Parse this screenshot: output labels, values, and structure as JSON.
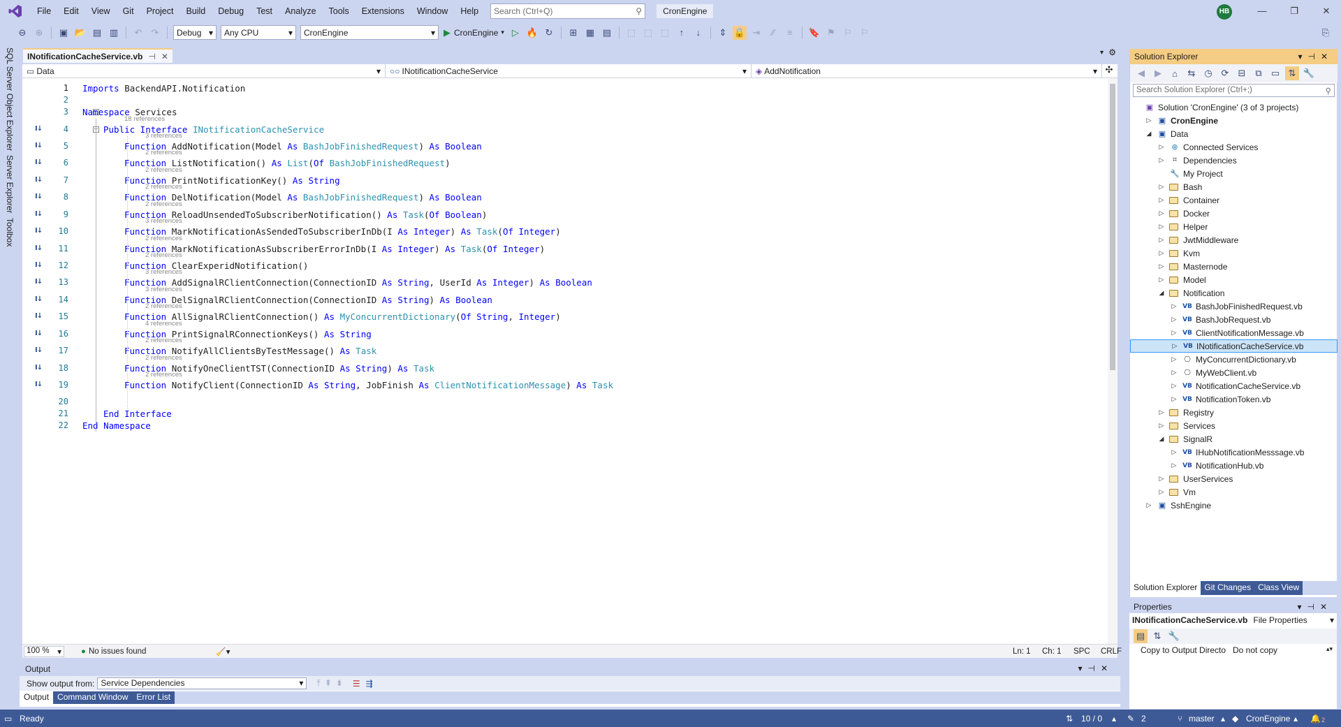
{
  "titlebar": {
    "menu": [
      "File",
      "Edit",
      "View",
      "Git",
      "Project",
      "Build",
      "Debug",
      "Test",
      "Analyze",
      "Tools",
      "Extensions",
      "Window",
      "Help"
    ],
    "search_placeholder": "Search (Ctrl+Q)",
    "solution_name": "CronEngine",
    "user_initials": "HB"
  },
  "toolbar": {
    "configuration": "Debug",
    "platform": "Any CPU",
    "startup_project": "CronEngine",
    "run_label": "CronEngine"
  },
  "left_rail": [
    "SQL Server Object Explorer",
    "Server Explorer",
    "Toolbox"
  ],
  "editor": {
    "tab_title": "INotificationCacheService.vb",
    "nav": {
      "project": "Data",
      "type": "INotificationCacheService",
      "member": "AddNotification"
    },
    "lines": [
      {
        "n": "1",
        "refs": "",
        "tokens": [
          {
            "t": "Imports",
            "c": "kw"
          },
          {
            "t": " BackendAPI.Notification",
            "c": ""
          }
        ]
      },
      {
        "n": "2",
        "refs": "",
        "tokens": []
      },
      {
        "n": "3",
        "refs": "",
        "tokens": [
          {
            "t": "Namespace",
            "c": "kw"
          },
          {
            "t": " Services",
            "c": ""
          }
        ]
      },
      {
        "n": "4",
        "refs": "18 references",
        "tokens": [
          {
            "t": "Public Interface",
            "c": "kw"
          },
          {
            "t": " ",
            "c": ""
          },
          {
            "t": "INotificationCacheService",
            "c": "ty"
          }
        ]
      },
      {
        "n": "5",
        "refs": "3 references",
        "tokens": [
          {
            "t": "Function",
            "c": "kw"
          },
          {
            "t": " AddNotification(Model ",
            "c": ""
          },
          {
            "t": "As",
            "c": "kw"
          },
          {
            "t": " ",
            "c": ""
          },
          {
            "t": "BashJobFinishedRequest",
            "c": "ty"
          },
          {
            "t": ") ",
            "c": ""
          },
          {
            "t": "As",
            "c": "kw"
          },
          {
            "t": " ",
            "c": ""
          },
          {
            "t": "Boolean",
            "c": "kw"
          }
        ]
      },
      {
        "n": "6",
        "refs": "2 references",
        "tokens": [
          {
            "t": "Function",
            "c": "kw"
          },
          {
            "t": " ListNotification() ",
            "c": ""
          },
          {
            "t": "As",
            "c": "kw"
          },
          {
            "t": " ",
            "c": ""
          },
          {
            "t": "List",
            "c": "ty"
          },
          {
            "t": "(",
            "c": ""
          },
          {
            "t": "Of",
            "c": "kw"
          },
          {
            "t": " ",
            "c": ""
          },
          {
            "t": "BashJobFinishedRequest",
            "c": "ty"
          },
          {
            "t": ")",
            "c": ""
          }
        ]
      },
      {
        "n": "7",
        "refs": "2 references",
        "tokens": [
          {
            "t": "Function",
            "c": "kw"
          },
          {
            "t": " PrintNotificationKey() ",
            "c": ""
          },
          {
            "t": "As",
            "c": "kw"
          },
          {
            "t": " ",
            "c": ""
          },
          {
            "t": "String",
            "c": "kw"
          }
        ]
      },
      {
        "n": "8",
        "refs": "2 references",
        "tokens": [
          {
            "t": "Function",
            "c": "kw"
          },
          {
            "t": " DelNotification(Model ",
            "c": ""
          },
          {
            "t": "As",
            "c": "kw"
          },
          {
            "t": " ",
            "c": ""
          },
          {
            "t": "BashJobFinishedRequest",
            "c": "ty"
          },
          {
            "t": ") ",
            "c": ""
          },
          {
            "t": "As",
            "c": "kw"
          },
          {
            "t": " ",
            "c": ""
          },
          {
            "t": "Boolean",
            "c": "kw"
          }
        ]
      },
      {
        "n": "9",
        "refs": "2 references",
        "tokens": [
          {
            "t": "Function",
            "c": "kw"
          },
          {
            "t": " ReloadUnsendedToSubscriberNotification() ",
            "c": ""
          },
          {
            "t": "As",
            "c": "kw"
          },
          {
            "t": " ",
            "c": ""
          },
          {
            "t": "Task",
            "c": "ty"
          },
          {
            "t": "(",
            "c": ""
          },
          {
            "t": "Of",
            "c": "kw"
          },
          {
            "t": " ",
            "c": ""
          },
          {
            "t": "Boolean",
            "c": "kw"
          },
          {
            "t": ")",
            "c": ""
          }
        ]
      },
      {
        "n": "10",
        "refs": "3 references",
        "tokens": [
          {
            "t": "Function",
            "c": "kw"
          },
          {
            "t": " MarkNotificationAsSendedToSubscriberInDb(I ",
            "c": ""
          },
          {
            "t": "As",
            "c": "kw"
          },
          {
            "t": " ",
            "c": ""
          },
          {
            "t": "Integer",
            "c": "kw"
          },
          {
            "t": ") ",
            "c": ""
          },
          {
            "t": "As",
            "c": "kw"
          },
          {
            "t": " ",
            "c": ""
          },
          {
            "t": "Task",
            "c": "ty"
          },
          {
            "t": "(",
            "c": ""
          },
          {
            "t": "Of",
            "c": "kw"
          },
          {
            "t": " ",
            "c": ""
          },
          {
            "t": "Integer",
            "c": "kw"
          },
          {
            "t": ")",
            "c": ""
          }
        ]
      },
      {
        "n": "11",
        "refs": "2 references",
        "tokens": [
          {
            "t": "Function",
            "c": "kw"
          },
          {
            "t": " MarkNotificationAsSubscriberErrorInDb(I ",
            "c": ""
          },
          {
            "t": "As",
            "c": "kw"
          },
          {
            "t": " ",
            "c": ""
          },
          {
            "t": "Integer",
            "c": "kw"
          },
          {
            "t": ") ",
            "c": ""
          },
          {
            "t": "As",
            "c": "kw"
          },
          {
            "t": " ",
            "c": ""
          },
          {
            "t": "Task",
            "c": "ty"
          },
          {
            "t": "(",
            "c": ""
          },
          {
            "t": "Of",
            "c": "kw"
          },
          {
            "t": " ",
            "c": ""
          },
          {
            "t": "Integer",
            "c": "kw"
          },
          {
            "t": ")",
            "c": ""
          }
        ]
      },
      {
        "n": "12",
        "refs": "2 references",
        "tokens": [
          {
            "t": "Function",
            "c": "kw"
          },
          {
            "t": " ClearExperidNotification()",
            "c": ""
          }
        ]
      },
      {
        "n": "13",
        "refs": "3 references",
        "tokens": [
          {
            "t": "Function",
            "c": "kw"
          },
          {
            "t": " AddSignalRClientConnection(ConnectionID ",
            "c": ""
          },
          {
            "t": "As",
            "c": "kw"
          },
          {
            "t": " ",
            "c": ""
          },
          {
            "t": "String",
            "c": "kw"
          },
          {
            "t": ", UserId ",
            "c": ""
          },
          {
            "t": "As",
            "c": "kw"
          },
          {
            "t": " ",
            "c": ""
          },
          {
            "t": "Integer",
            "c": "kw"
          },
          {
            "t": ") ",
            "c": ""
          },
          {
            "t": "As",
            "c": "kw"
          },
          {
            "t": " ",
            "c": ""
          },
          {
            "t": "Boolean",
            "c": "kw"
          }
        ]
      },
      {
        "n": "14",
        "refs": "3 references",
        "tokens": [
          {
            "t": "Function",
            "c": "kw"
          },
          {
            "t": " DelSignalRClientConnection(ConnectionID ",
            "c": ""
          },
          {
            "t": "As",
            "c": "kw"
          },
          {
            "t": " ",
            "c": ""
          },
          {
            "t": "String",
            "c": "kw"
          },
          {
            "t": ") ",
            "c": ""
          },
          {
            "t": "As",
            "c": "kw"
          },
          {
            "t": " ",
            "c": ""
          },
          {
            "t": "Boolean",
            "c": "kw"
          }
        ]
      },
      {
        "n": "15",
        "refs": "2 references",
        "tokens": [
          {
            "t": "Function",
            "c": "kw"
          },
          {
            "t": " AllSignalRClientConnection() ",
            "c": ""
          },
          {
            "t": "As",
            "c": "kw"
          },
          {
            "t": " ",
            "c": ""
          },
          {
            "t": "MyConcurrentDictionary",
            "c": "ty"
          },
          {
            "t": "(",
            "c": ""
          },
          {
            "t": "Of",
            "c": "kw"
          },
          {
            "t": " ",
            "c": ""
          },
          {
            "t": "String",
            "c": "kw"
          },
          {
            "t": ", ",
            "c": ""
          },
          {
            "t": "Integer",
            "c": "kw"
          },
          {
            "t": ")",
            "c": ""
          }
        ]
      },
      {
        "n": "16",
        "refs": "4 references",
        "tokens": [
          {
            "t": "Function",
            "c": "kw"
          },
          {
            "t": " PrintSignalRConnectionKeys() ",
            "c": ""
          },
          {
            "t": "As",
            "c": "kw"
          },
          {
            "t": " ",
            "c": ""
          },
          {
            "t": "String",
            "c": "kw"
          }
        ]
      },
      {
        "n": "17",
        "refs": "2 references",
        "tokens": [
          {
            "t": "Function",
            "c": "kw"
          },
          {
            "t": " NotifyAllClientsByTestMessage() ",
            "c": ""
          },
          {
            "t": "As",
            "c": "kw"
          },
          {
            "t": " ",
            "c": ""
          },
          {
            "t": "Task",
            "c": "ty"
          }
        ]
      },
      {
        "n": "18",
        "refs": "2 references",
        "tokens": [
          {
            "t": "Function",
            "c": "kw"
          },
          {
            "t": " NotifyOneClientTST(ConnectionID ",
            "c": ""
          },
          {
            "t": "As",
            "c": "kw"
          },
          {
            "t": " ",
            "c": ""
          },
          {
            "t": "String",
            "c": "kw"
          },
          {
            "t": ") ",
            "c": ""
          },
          {
            "t": "As",
            "c": "kw"
          },
          {
            "t": " ",
            "c": ""
          },
          {
            "t": "Task",
            "c": "ty"
          }
        ]
      },
      {
        "n": "19",
        "refs": "2 references",
        "tokens": [
          {
            "t": "Function",
            "c": "kw"
          },
          {
            "t": " NotifyClient(ConnectionID ",
            "c": ""
          },
          {
            "t": "As",
            "c": "kw"
          },
          {
            "t": " ",
            "c": ""
          },
          {
            "t": "String",
            "c": "kw"
          },
          {
            "t": ", JobFinish ",
            "c": ""
          },
          {
            "t": "As",
            "c": "kw"
          },
          {
            "t": " ",
            "c": ""
          },
          {
            "t": "ClientNotificationMessage",
            "c": "ty"
          },
          {
            "t": ") ",
            "c": ""
          },
          {
            "t": "As",
            "c": "kw"
          },
          {
            "t": " ",
            "c": ""
          },
          {
            "t": "Task",
            "c": "ty"
          }
        ]
      },
      {
        "n": "20",
        "refs": "",
        "tokens": []
      },
      {
        "n": "21",
        "refs": "",
        "tokens": [
          {
            "t": "End Interface",
            "c": "kw"
          }
        ]
      },
      {
        "n": "22",
        "refs": "",
        "tokens": [
          {
            "t": "End Namespace",
            "c": "kw"
          }
        ]
      }
    ],
    "status": {
      "zoom": "100 %",
      "issues": "No issues found",
      "line": "Ln: 1",
      "col": "Ch: 1",
      "whitespace": "SPC",
      "eol": "CRLF"
    }
  },
  "output": {
    "title": "Output",
    "show_from_label": "Show output from:",
    "source": "Service Dependencies",
    "tabs": [
      "Output",
      "Command Window",
      "Error List"
    ]
  },
  "solution_explorer": {
    "title": "Solution Explorer",
    "search_placeholder": "Search Solution Explorer (Ctrl+;)",
    "tree": [
      {
        "label": "Solution 'CronEngine' (3 of 3 projects)",
        "depth": 0,
        "icon": "solution",
        "tw": ""
      },
      {
        "label": "CronEngine",
        "depth": 1,
        "icon": "project",
        "tw": "▷",
        "bold": true
      },
      {
        "label": "Data",
        "depth": 1,
        "icon": "project",
        "tw": "◢"
      },
      {
        "label": "Connected Services",
        "depth": 2,
        "icon": "connected",
        "tw": "▷"
      },
      {
        "label": "Dependencies",
        "depth": 2,
        "icon": "deps",
        "tw": "▷"
      },
      {
        "label": "My Project",
        "depth": 2,
        "icon": "wrench",
        "tw": ""
      },
      {
        "label": "Bash",
        "depth": 2,
        "icon": "folder",
        "tw": "▷"
      },
      {
        "label": "Container",
        "depth": 2,
        "icon": "folder",
        "tw": "▷"
      },
      {
        "label": "Docker",
        "depth": 2,
        "icon": "folder",
        "tw": "▷"
      },
      {
        "label": "Helper",
        "depth": 2,
        "icon": "folder",
        "tw": "▷"
      },
      {
        "label": "JwtMiddleware",
        "depth": 2,
        "icon": "folder",
        "tw": "▷"
      },
      {
        "label": "Kvm",
        "depth": 2,
        "icon": "folder",
        "tw": "▷"
      },
      {
        "label": "Masternode",
        "depth": 2,
        "icon": "folder",
        "tw": "▷"
      },
      {
        "label": "Model",
        "depth": 2,
        "icon": "folder",
        "tw": "▷"
      },
      {
        "label": "Notification",
        "depth": 2,
        "icon": "folder",
        "tw": "◢"
      },
      {
        "label": "BashJobFinishedRequest.vb",
        "depth": 3,
        "icon": "vb",
        "tw": "▷"
      },
      {
        "label": "BashJobRequest.vb",
        "depth": 3,
        "icon": "vb",
        "tw": "▷"
      },
      {
        "label": "ClientNotificationMessage.vb",
        "depth": 3,
        "icon": "vb",
        "tw": "▷"
      },
      {
        "label": "INotificationCacheService.vb",
        "depth": 3,
        "icon": "vb",
        "tw": "▷",
        "selected": true
      },
      {
        "label": "MyConcurrentDictionary.vb",
        "depth": 3,
        "icon": "class",
        "tw": "▷"
      },
      {
        "label": "MyWebClient.vb",
        "depth": 3,
        "icon": "class",
        "tw": "▷"
      },
      {
        "label": "NotificationCacheService.vb",
        "depth": 3,
        "icon": "vb",
        "tw": "▷"
      },
      {
        "label": "NotificationToken.vb",
        "depth": 3,
        "icon": "vb",
        "tw": "▷"
      },
      {
        "label": "Registry",
        "depth": 2,
        "icon": "folder",
        "tw": "▷"
      },
      {
        "label": "Services",
        "depth": 2,
        "icon": "folder",
        "tw": "▷"
      },
      {
        "label": "SignalR",
        "depth": 2,
        "icon": "folder",
        "tw": "◢"
      },
      {
        "label": "IHubNotificationMesssage.vb",
        "depth": 3,
        "icon": "vb",
        "tw": "▷"
      },
      {
        "label": "NotificationHub.vb",
        "depth": 3,
        "icon": "vb",
        "tw": "▷"
      },
      {
        "label": "UserServices",
        "depth": 2,
        "icon": "folder",
        "tw": "▷"
      },
      {
        "label": "Vm",
        "depth": 2,
        "icon": "folder",
        "tw": "▷"
      },
      {
        "label": "SshEngine",
        "depth": 1,
        "icon": "project",
        "tw": "▷"
      }
    ],
    "bottom_tabs": [
      "Solution Explorer",
      "Git Changes",
      "Class View"
    ]
  },
  "properties": {
    "title": "Properties",
    "object_name": "INotificationCacheService.vb",
    "object_type": "File Properties",
    "rows": [
      {
        "name": "Copy to Output Directo",
        "value": "Do not copy"
      }
    ]
  },
  "statusbar": {
    "state": "Ready",
    "git_changes": "10 / 0",
    "pending_edits": "2",
    "branch": "master",
    "repo": "CronEngine",
    "notifications": "2"
  },
  "icons": {
    "vb_file": "VB",
    "impl_marker": "I↓"
  },
  "colors": {
    "keyword": "#0000ff",
    "type": "#2b91af",
    "accent_tab": "#f5cc84",
    "statusbar": "#3e5a96",
    "chrome": "#ccd5f0"
  }
}
